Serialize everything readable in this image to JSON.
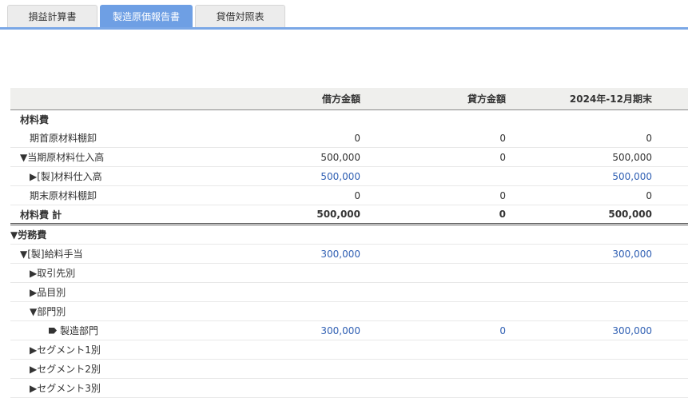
{
  "tabs": [
    "損益計算書",
    "製造原価報告書",
    "貸借対照表"
  ],
  "columns": [
    "",
    "借方金額",
    "貸方金額",
    "2024年-12月期末"
  ],
  "rows": [
    {
      "label": "材料費",
      "c1": "",
      "c2": "",
      "c3": ""
    },
    {
      "label": "期首原材料棚卸",
      "c1": "0",
      "c2": "0",
      "c3": "0"
    },
    {
      "label": "▼当期原材料仕入高",
      "c1": "500,000",
      "c2": "0",
      "c3": "500,000"
    },
    {
      "label": "▶[製]材料仕入高",
      "c1": "500,000",
      "c2": "",
      "c3": "500,000"
    },
    {
      "label": "期末原材料棚卸",
      "c1": "0",
      "c2": "0",
      "c3": "0"
    },
    {
      "label": "材料費 計",
      "c1": "500,000",
      "c2": "0",
      "c3": "500,000"
    },
    {
      "label": "▼労務費",
      "c1": "",
      "c2": "",
      "c3": ""
    },
    {
      "label": "▼[製]給料手当",
      "c1": "300,000",
      "c2": "",
      "c3": "300,000"
    },
    {
      "label": "▶取引先別",
      "c1": "",
      "c2": "",
      "c3": ""
    },
    {
      "label": "▶品目別",
      "c1": "",
      "c2": "",
      "c3": ""
    },
    {
      "label": "▼部門別",
      "c1": "",
      "c2": "",
      "c3": ""
    },
    {
      "label": "製造部門",
      "c1": "300,000",
      "c2": "0",
      "c3": "300,000"
    },
    {
      "label": "▶セグメント1別",
      "c1": "",
      "c2": "",
      "c3": ""
    },
    {
      "label": "▶セグメント2別",
      "c1": "",
      "c2": "",
      "c3": ""
    },
    {
      "label": "▶セグメント3別",
      "c1": "",
      "c2": "",
      "c3": ""
    }
  ]
}
